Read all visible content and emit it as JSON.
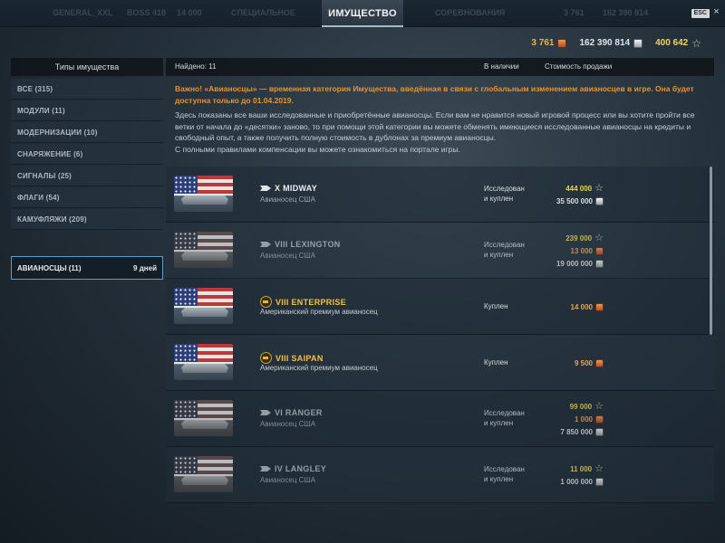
{
  "top_bar": {
    "active_tab": "ИМУЩЕСТВО",
    "esc_label": "ESC",
    "close_glyph": "×",
    "background_items": [
      "GENERAL_XXL",
      "BOSS 418",
      "14 000",
      "СПЕЦИАЛЬНОЕ",
      "СОРЕВНОВАНИЯ",
      "3 761",
      "162 390 814",
      "400 642"
    ]
  },
  "currencies": {
    "doubloons": "3 761",
    "credits": "162 390 814",
    "free_xp": "400 642"
  },
  "left": {
    "header": "Типы имущества",
    "categories": [
      {
        "label": "ВСЕ (315)"
      },
      {
        "label": "МОДУЛИ (11)"
      },
      {
        "label": "МОДЕРНИЗАЦИИ (10)"
      },
      {
        "label": "СНАРЯЖЕНИЕ (6)"
      },
      {
        "label": "СИГНАЛЫ (25)"
      },
      {
        "label": "ФЛАГИ (54)"
      },
      {
        "label": "КАМУФЛЯЖИ (209)"
      }
    ],
    "active_category": {
      "label": "АВИАНОСЦЫ (11)",
      "days": "9 дней"
    }
  },
  "panel": {
    "found": "Найдено: 11",
    "col_available": "В наличии",
    "col_price": "Стоимость продажи",
    "warning": "Важно! «Авианосцы» — временная категория Имущества, введённая в связи с глобальным изменением авианосцев в игре. Она будет доступна только до 01.04.2019.",
    "description_1": "Здесь показаны все ваши исследованные и приобретённые авианосцы. Если вам не нравится новый игровой процесс или вы хотите пройти все ветки от начала до «десятки» заново, то при помощи этой категории вы можете обменять имеющиеся исследованные авианосцы на кредиты и свободный опыт, а также получить полную стоимость в дублонах за премиум авианосцы.",
    "description_2": "С полными правилами компенсации вы можете ознакомиться на портале игры."
  },
  "ships": [
    {
      "name": "X MIDWAY",
      "subtitle": "Авианосец США",
      "status_1": "Исследован",
      "status_2": "и куплен",
      "premium": false,
      "prices": [
        {
          "type": "xp",
          "value": "444 000"
        },
        {
          "type": "credits",
          "value": "35 500 000"
        }
      ]
    },
    {
      "name": "VIII LEXINGTON",
      "subtitle": "Авианосец США",
      "status_1": "Исследован",
      "status_2": "и куплен",
      "premium": false,
      "prices": [
        {
          "type": "xp",
          "value": "239 000"
        },
        {
          "type": "doubloons",
          "value": "13 000"
        },
        {
          "type": "credits",
          "value": "19 000 000"
        }
      ]
    },
    {
      "name": "VIII ENTERPRISE",
      "subtitle": "Американский премиум авианосец",
      "status_1": "Куплен",
      "status_2": "",
      "premium": true,
      "prices": [
        {
          "type": "doubloons",
          "value": "14 000"
        }
      ]
    },
    {
      "name": "VIII SAIPAN",
      "subtitle": "Американский премиум авианосец",
      "status_1": "Куплен",
      "status_2": "",
      "premium": true,
      "prices": [
        {
          "type": "doubloons",
          "value": "9 500"
        }
      ]
    },
    {
      "name": "VI RANGER",
      "subtitle": "Авианосец США",
      "status_1": "Исследован",
      "status_2": "и куплен",
      "premium": false,
      "prices": [
        {
          "type": "xp",
          "value": "99 000"
        },
        {
          "type": "doubloons",
          "value": "1 000"
        },
        {
          "type": "credits",
          "value": "7 850 000"
        }
      ]
    },
    {
      "name": "IV LANGLEY",
      "subtitle": "Авианосец США",
      "status_1": "Исследован",
      "status_2": "и куплен",
      "premium": false,
      "prices": [
        {
          "type": "xp",
          "value": "11 000"
        },
        {
          "type": "credits",
          "value": "1 000 000"
        }
      ]
    }
  ]
}
